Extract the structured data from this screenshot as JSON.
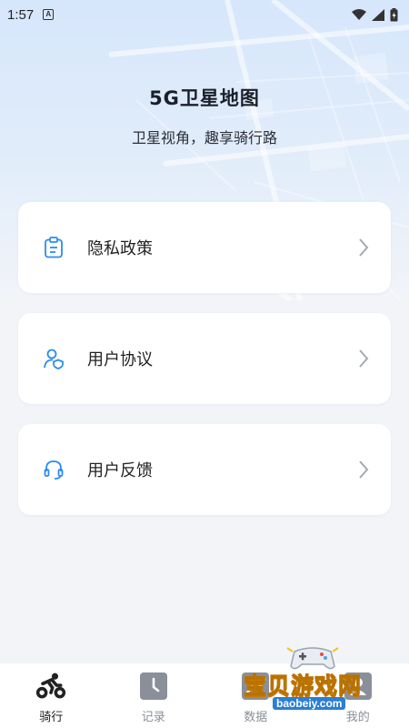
{
  "status_bar": {
    "time": "1:57",
    "badge": "A"
  },
  "hero": {
    "title": "5G卫星地图",
    "subtitle": "卫星视角，趣享骑行路"
  },
  "menu": [
    {
      "label": "隐私政策",
      "icon": "clipboard-icon"
    },
    {
      "label": "用户协议",
      "icon": "user-shield-icon"
    },
    {
      "label": "用户反馈",
      "icon": "headset-icon"
    }
  ],
  "tabs": [
    {
      "label": "骑行",
      "icon": "cycling-icon",
      "active": true
    },
    {
      "label": "记录",
      "icon": "clock-doc-icon",
      "active": false
    },
    {
      "label": "数据",
      "icon": "chart-icon",
      "active": false
    },
    {
      "label": "我的",
      "icon": "user-icon",
      "active": false
    }
  ],
  "watermark": {
    "text": "宝贝游戏网",
    "url": "baobeiy.com"
  },
  "colors": {
    "accent": "#2a8df0",
    "tab_inactive": "#8a8f99",
    "tab_active": "#222222"
  }
}
